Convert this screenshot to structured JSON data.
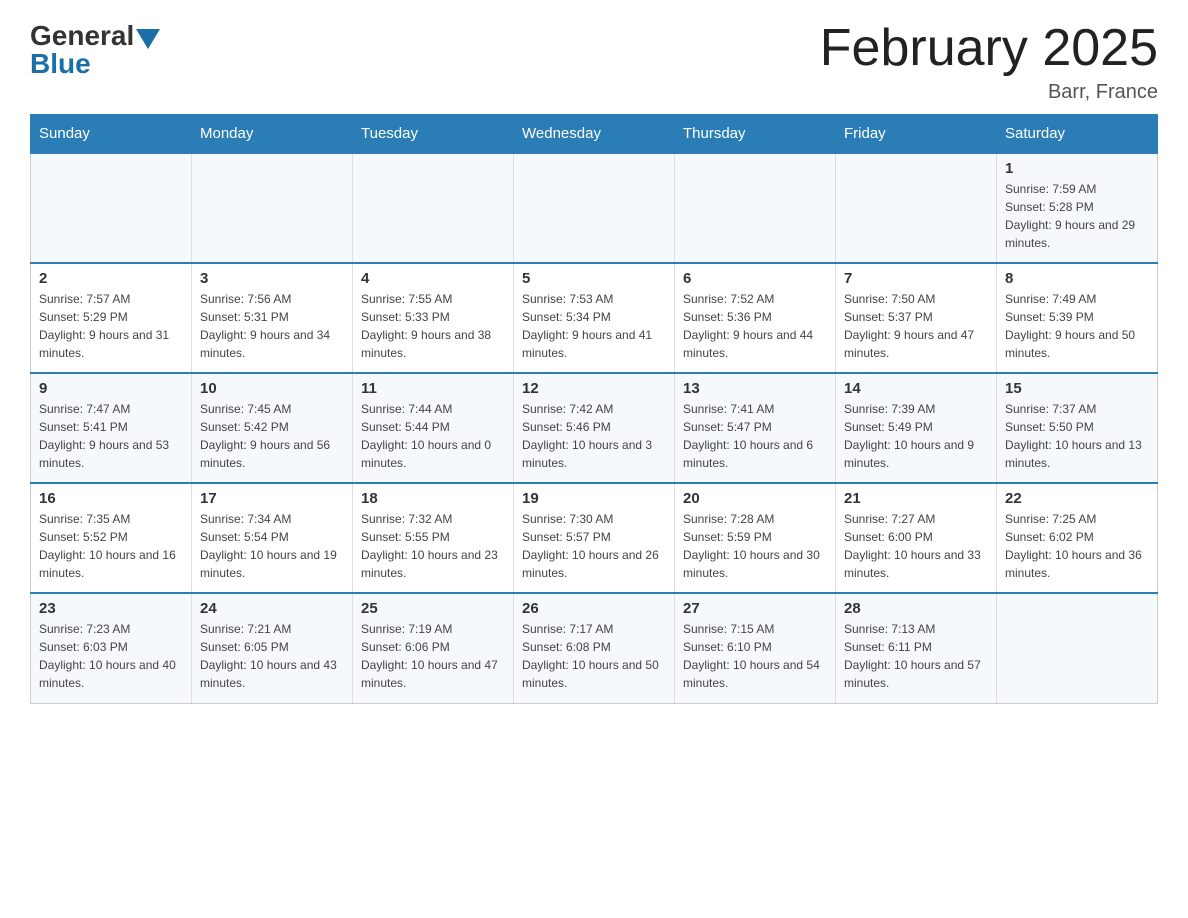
{
  "header": {
    "logo_general": "General",
    "logo_blue": "Blue",
    "title": "February 2025",
    "location": "Barr, France"
  },
  "days_of_week": [
    "Sunday",
    "Monday",
    "Tuesday",
    "Wednesday",
    "Thursday",
    "Friday",
    "Saturday"
  ],
  "weeks": [
    {
      "days": [
        {
          "number": "",
          "info": ""
        },
        {
          "number": "",
          "info": ""
        },
        {
          "number": "",
          "info": ""
        },
        {
          "number": "",
          "info": ""
        },
        {
          "number": "",
          "info": ""
        },
        {
          "number": "",
          "info": ""
        },
        {
          "number": "1",
          "info": "Sunrise: 7:59 AM\nSunset: 5:28 PM\nDaylight: 9 hours and 29 minutes."
        }
      ]
    },
    {
      "days": [
        {
          "number": "2",
          "info": "Sunrise: 7:57 AM\nSunset: 5:29 PM\nDaylight: 9 hours and 31 minutes."
        },
        {
          "number": "3",
          "info": "Sunrise: 7:56 AM\nSunset: 5:31 PM\nDaylight: 9 hours and 34 minutes."
        },
        {
          "number": "4",
          "info": "Sunrise: 7:55 AM\nSunset: 5:33 PM\nDaylight: 9 hours and 38 minutes."
        },
        {
          "number": "5",
          "info": "Sunrise: 7:53 AM\nSunset: 5:34 PM\nDaylight: 9 hours and 41 minutes."
        },
        {
          "number": "6",
          "info": "Sunrise: 7:52 AM\nSunset: 5:36 PM\nDaylight: 9 hours and 44 minutes."
        },
        {
          "number": "7",
          "info": "Sunrise: 7:50 AM\nSunset: 5:37 PM\nDaylight: 9 hours and 47 minutes."
        },
        {
          "number": "8",
          "info": "Sunrise: 7:49 AM\nSunset: 5:39 PM\nDaylight: 9 hours and 50 minutes."
        }
      ]
    },
    {
      "days": [
        {
          "number": "9",
          "info": "Sunrise: 7:47 AM\nSunset: 5:41 PM\nDaylight: 9 hours and 53 minutes."
        },
        {
          "number": "10",
          "info": "Sunrise: 7:45 AM\nSunset: 5:42 PM\nDaylight: 9 hours and 56 minutes."
        },
        {
          "number": "11",
          "info": "Sunrise: 7:44 AM\nSunset: 5:44 PM\nDaylight: 10 hours and 0 minutes."
        },
        {
          "number": "12",
          "info": "Sunrise: 7:42 AM\nSunset: 5:46 PM\nDaylight: 10 hours and 3 minutes."
        },
        {
          "number": "13",
          "info": "Sunrise: 7:41 AM\nSunset: 5:47 PM\nDaylight: 10 hours and 6 minutes."
        },
        {
          "number": "14",
          "info": "Sunrise: 7:39 AM\nSunset: 5:49 PM\nDaylight: 10 hours and 9 minutes."
        },
        {
          "number": "15",
          "info": "Sunrise: 7:37 AM\nSunset: 5:50 PM\nDaylight: 10 hours and 13 minutes."
        }
      ]
    },
    {
      "days": [
        {
          "number": "16",
          "info": "Sunrise: 7:35 AM\nSunset: 5:52 PM\nDaylight: 10 hours and 16 minutes."
        },
        {
          "number": "17",
          "info": "Sunrise: 7:34 AM\nSunset: 5:54 PM\nDaylight: 10 hours and 19 minutes."
        },
        {
          "number": "18",
          "info": "Sunrise: 7:32 AM\nSunset: 5:55 PM\nDaylight: 10 hours and 23 minutes."
        },
        {
          "number": "19",
          "info": "Sunrise: 7:30 AM\nSunset: 5:57 PM\nDaylight: 10 hours and 26 minutes."
        },
        {
          "number": "20",
          "info": "Sunrise: 7:28 AM\nSunset: 5:59 PM\nDaylight: 10 hours and 30 minutes."
        },
        {
          "number": "21",
          "info": "Sunrise: 7:27 AM\nSunset: 6:00 PM\nDaylight: 10 hours and 33 minutes."
        },
        {
          "number": "22",
          "info": "Sunrise: 7:25 AM\nSunset: 6:02 PM\nDaylight: 10 hours and 36 minutes."
        }
      ]
    },
    {
      "days": [
        {
          "number": "23",
          "info": "Sunrise: 7:23 AM\nSunset: 6:03 PM\nDaylight: 10 hours and 40 minutes."
        },
        {
          "number": "24",
          "info": "Sunrise: 7:21 AM\nSunset: 6:05 PM\nDaylight: 10 hours and 43 minutes."
        },
        {
          "number": "25",
          "info": "Sunrise: 7:19 AM\nSunset: 6:06 PM\nDaylight: 10 hours and 47 minutes."
        },
        {
          "number": "26",
          "info": "Sunrise: 7:17 AM\nSunset: 6:08 PM\nDaylight: 10 hours and 50 minutes."
        },
        {
          "number": "27",
          "info": "Sunrise: 7:15 AM\nSunset: 6:10 PM\nDaylight: 10 hours and 54 minutes."
        },
        {
          "number": "28",
          "info": "Sunrise: 7:13 AM\nSunset: 6:11 PM\nDaylight: 10 hours and 57 minutes."
        },
        {
          "number": "",
          "info": ""
        }
      ]
    }
  ]
}
